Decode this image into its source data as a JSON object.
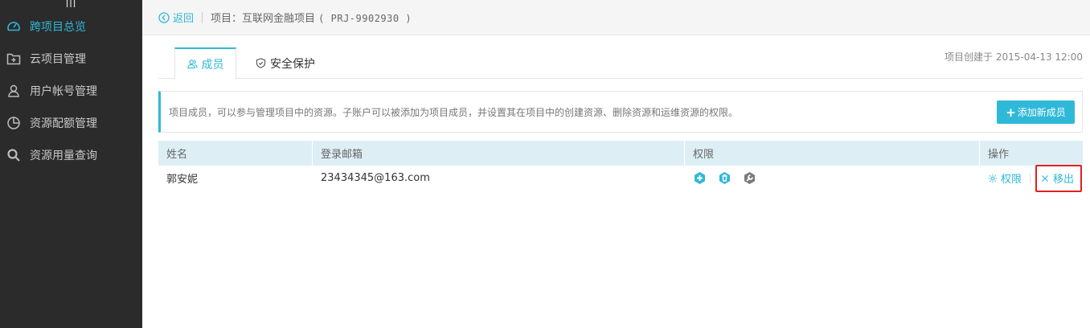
{
  "sidebar": {
    "collapse_glyph": "III",
    "items": [
      {
        "label": "跨项目总览",
        "icon": "dashboard-icon",
        "active": true
      },
      {
        "label": "云项目管理",
        "icon": "folder-add-icon",
        "active": false
      },
      {
        "label": "用户帐号管理",
        "icon": "user-icon",
        "active": false
      },
      {
        "label": "资源配额管理",
        "icon": "pie-chart-icon",
        "active": false
      },
      {
        "label": "资源用量查询",
        "icon": "search-icon",
        "active": false
      }
    ]
  },
  "topbar": {
    "back_label": "返回",
    "project_label": "项目：互联网金融项目",
    "project_code": "( PRJ-9902930 )"
  },
  "tabs": [
    {
      "label": "成员",
      "icon": "users-icon",
      "active": true
    },
    {
      "label": "安全保护",
      "icon": "shield-icon",
      "active": false
    }
  ],
  "created_text": "项目创建于 2015-04-13 12:00",
  "info": {
    "text": "项目成员，可以参与管理项目中的资源。子账户可以被添加为项目成员，并设置其在项目中的创建资源、删除资源和运维资源的权限。",
    "add_button": "添加新成员"
  },
  "table": {
    "headers": [
      "姓名",
      "登录邮箱",
      "权限",
      "操作"
    ],
    "rows": [
      {
        "name": "郭安妮",
        "email": "23434345@163.com",
        "permissions": [
          "create-permission-icon",
          "delete-permission-icon",
          "ops-permission-icon"
        ],
        "actions": {
          "permission": "权限",
          "remove": "移出"
        }
      }
    ]
  },
  "colors": {
    "accent": "#2fb8d8",
    "sidebar_bg": "#2b2b2b",
    "table_header_bg": "#ddeff5",
    "highlight_border": "#e02020",
    "permission_disabled": "#7a7a7a"
  }
}
